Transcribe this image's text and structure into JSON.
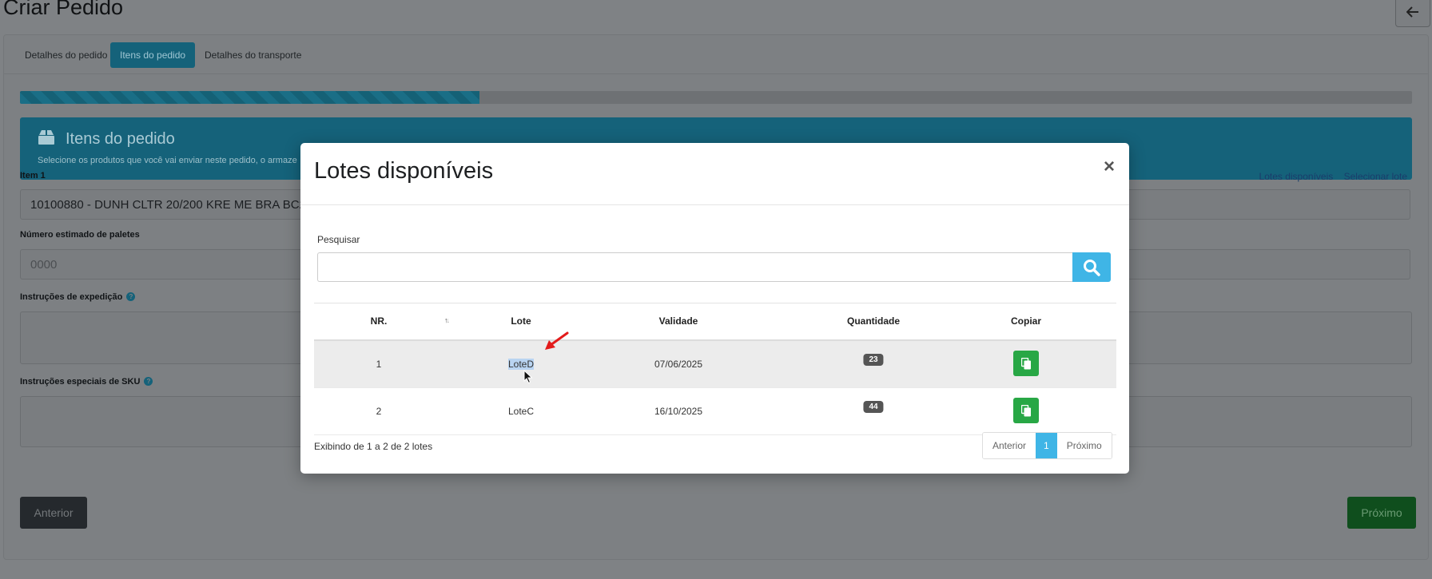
{
  "page": {
    "title": "Criar Pedido"
  },
  "tabs": [
    {
      "label": "Detalhes do pedido"
    },
    {
      "label": "Itens do pedido"
    },
    {
      "label": "Detalhes do transporte"
    }
  ],
  "progress": {
    "percent": 33
  },
  "banner": {
    "title": "Itens do pedido",
    "text": "Selecione os produtos que você vai enviar neste pedido, o armaze"
  },
  "item": {
    "label": "Item 1",
    "value": "10100880 - DUNH CLTR 20/200 KRE ME BRA BC2",
    "links": {
      "lotes": "Lotes disponíveis",
      "selecionar": "Selecionar lote"
    }
  },
  "pallets": {
    "label": "Número estimado de paletes",
    "placeholder": "0000"
  },
  "shipping": {
    "label": "Instruções de expedição"
  },
  "sku": {
    "label": "Instruções especiais de SKU"
  },
  "nav": {
    "prev": "Anterior",
    "next": "Próximo"
  },
  "modal": {
    "title": "Lotes disponíveis",
    "close": "×",
    "search_label": "Pesquisar",
    "columns": {
      "nr": "NR.",
      "lote": "Lote",
      "validade": "Validade",
      "quantidade": "Quantidade",
      "copiar": "Copiar"
    },
    "rows": [
      {
        "nr": "1",
        "lote": "LoteD",
        "validade": "07/06/2025",
        "quantidade": "23"
      },
      {
        "nr": "2",
        "lote": "LoteC",
        "validade": "16/10/2025",
        "quantidade": "44"
      }
    ],
    "footer": "Exibindo de 1 a 2 de 2 lotes",
    "pager": {
      "prev": "Anterior",
      "current": "1",
      "next": "Próximo"
    }
  },
  "colors": {
    "accent": "#3fb5e6",
    "success": "#28a745",
    "banner": "#17a2b8",
    "annotation": "#e31b1b"
  }
}
